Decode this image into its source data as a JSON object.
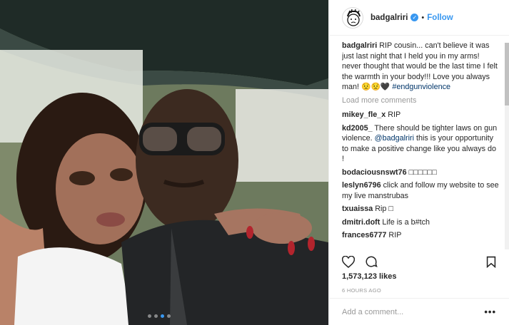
{
  "header": {
    "username": "badgalriri",
    "separator": "•",
    "follow_label": "Follow",
    "verified_glyph": "✓"
  },
  "caption": {
    "username": "badgalriri",
    "text": " RIP cousin... can't believe it was just last night that I held you in my arms! never thought that would be the last time I felt the warmth in your body!!! Love you always man! 😟😟🖤 ",
    "hashtag": "#endgunviolence"
  },
  "load_more_label": "Load more comments",
  "comments": [
    {
      "user": "mikey_fle_x",
      "text": " RIP"
    },
    {
      "user": "kd2005_",
      "text": " There should be tighter laws on gun violence. ",
      "mention": "@badgalriri",
      "text_after": " this is your opportunity to make a positive change like you always do !"
    },
    {
      "user": "bodaciousnswt76",
      "text": " □□□□□□"
    },
    {
      "user": "leslyn6796",
      "text": " click and follow my website to see my live manstrubas"
    },
    {
      "user": "txuaissa",
      "text": " Rip □"
    },
    {
      "user": "dmitri.doft",
      "text": " Life is a b#tch"
    },
    {
      "user": "frances6777",
      "text": " RIP"
    }
  ],
  "likes": "1,573,123 likes",
  "timestamp": "6 HOURS AGO",
  "add_comment": {
    "placeholder": "Add a comment...",
    "more_label": "•••"
  },
  "carousel": {
    "count": 4,
    "active_index": 2
  },
  "icons": [
    "heart-icon",
    "comment-icon",
    "bookmark-icon",
    "verified-icon"
  ],
  "colors": {
    "accent": "#3897f0",
    "link": "#003569",
    "muted": "#999999"
  }
}
